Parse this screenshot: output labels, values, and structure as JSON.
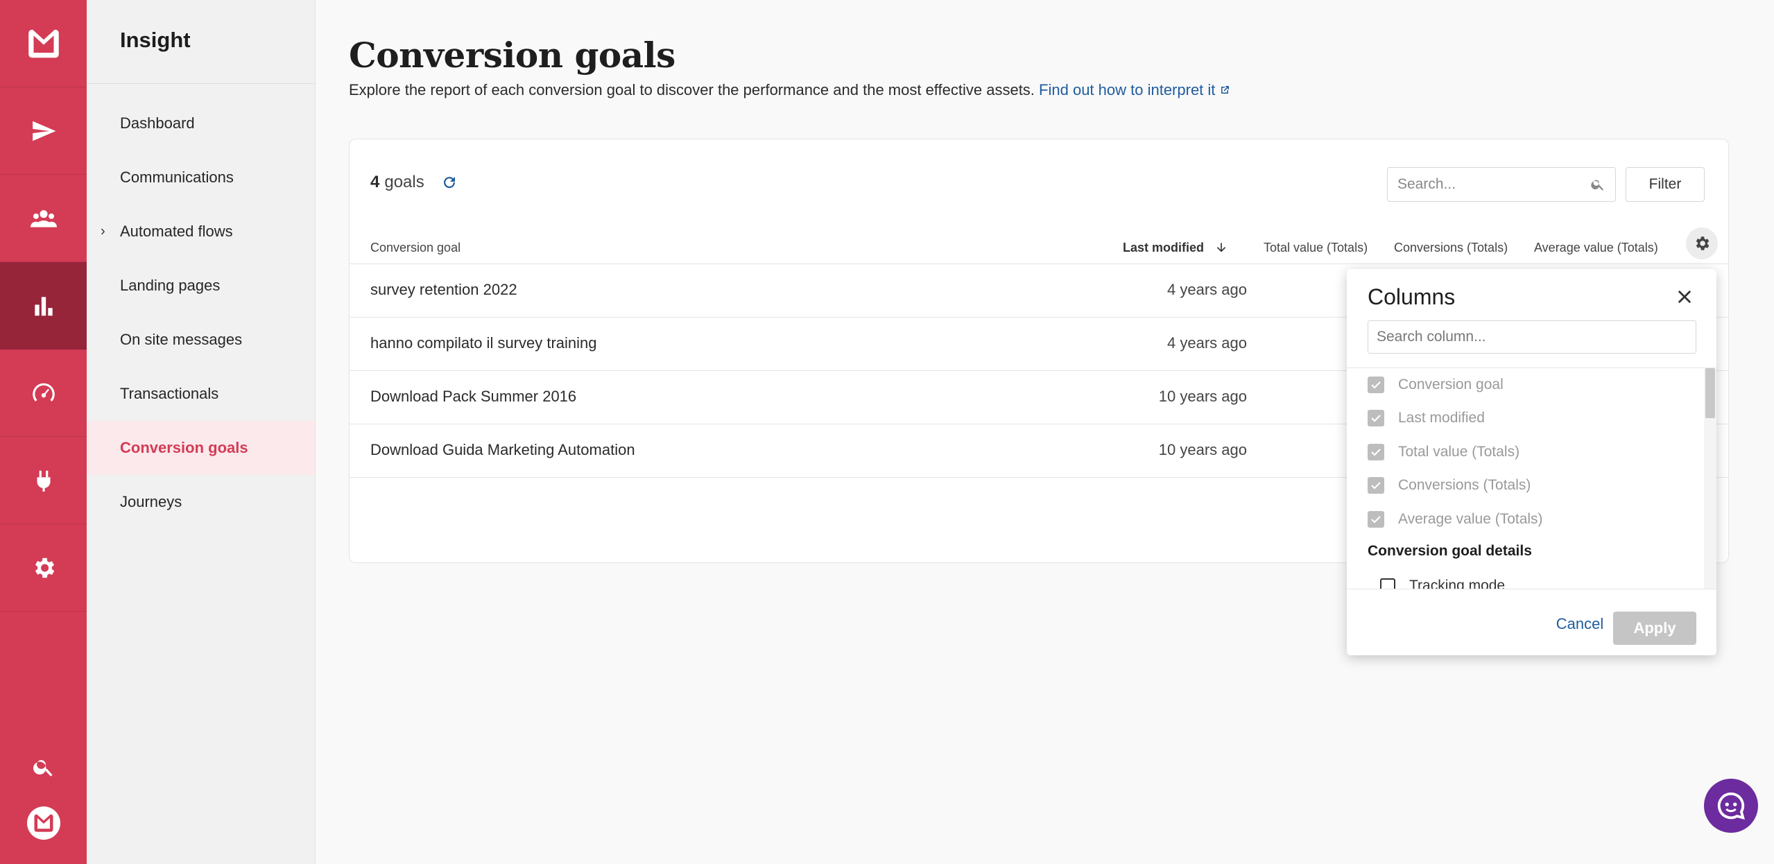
{
  "app": {
    "section_title": "Insight"
  },
  "rail": {
    "items": [
      {
        "icon": "logo-icon"
      },
      {
        "icon": "send-icon"
      },
      {
        "icon": "contacts-icon"
      },
      {
        "icon": "chart-icon"
      },
      {
        "icon": "speedometer-icon"
      },
      {
        "icon": "plug-icon"
      },
      {
        "icon": "gear-icon"
      }
    ],
    "active_color": "#96253a",
    "color": "#d43b55"
  },
  "sidebar": {
    "items": [
      {
        "label": "Dashboard"
      },
      {
        "label": "Communications"
      },
      {
        "label": "Automated flows"
      },
      {
        "label": "Landing pages"
      },
      {
        "label": "On site messages"
      },
      {
        "label": "Transactionals"
      },
      {
        "label": "Conversion goals"
      },
      {
        "label": "Journeys"
      }
    ]
  },
  "page": {
    "title": "Conversion goals",
    "description": "Explore the report of each conversion goal to discover the performance and the most effective assets.",
    "help_link": "Find out how to interpret it"
  },
  "toolbar": {
    "count": "4",
    "count_label": "goals",
    "search_placeholder": "Search...",
    "filter_label": "Filter"
  },
  "table": {
    "headers": {
      "goal": "Conversion goal",
      "modified": "Last modified",
      "total": "Total value (Totals)",
      "conversions": "Conversions (Totals)",
      "average": "Average value (Totals)"
    },
    "rows": [
      {
        "name": "survey retention 2022",
        "modified": "4 years ago"
      },
      {
        "name": "hanno compilato il survey training",
        "modified": "4 years ago"
      },
      {
        "name": "Download Pack Summer 2016",
        "modified": "10 years ago"
      },
      {
        "name": "Download Guida Marketing Automation",
        "modified": "10 years ago"
      }
    ]
  },
  "columns_popover": {
    "title": "Columns",
    "search_placeholder": "Search column...",
    "items": [
      {
        "label": "Conversion goal",
        "checked": true
      },
      {
        "label": "Last modified",
        "checked": true
      },
      {
        "label": "Total value (Totals)",
        "checked": true
      },
      {
        "label": "Conversions (Totals)",
        "checked": true
      },
      {
        "label": "Average value (Totals)",
        "checked": true
      }
    ],
    "group_title": "Conversion goal details",
    "group_items": [
      {
        "label": "Tracking mode",
        "checked": false
      }
    ],
    "cancel_label": "Cancel",
    "apply_label": "Apply"
  },
  "colors": {
    "brand": "#d43b55",
    "link": "#1f5c9e",
    "chat": "#6c2b9e"
  }
}
